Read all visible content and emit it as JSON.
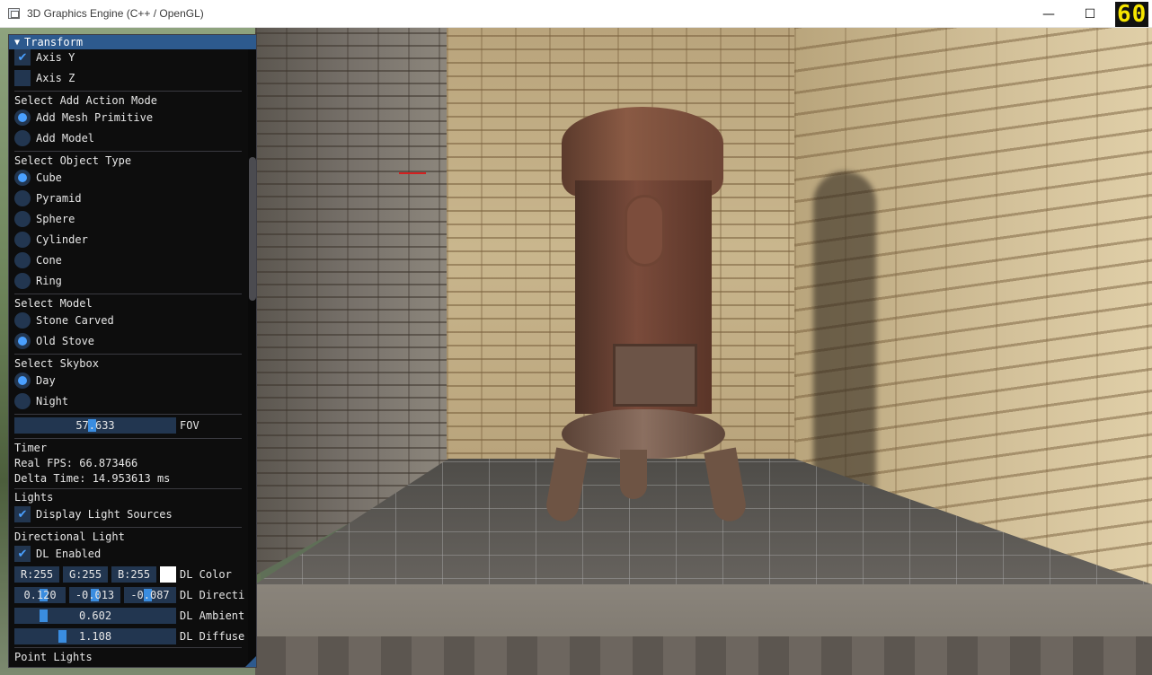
{
  "window": {
    "title": "3D Graphics Engine (C++ / OpenGL)",
    "minimize_glyph": "—",
    "maximize_glyph": "☐",
    "close_glyph": "✕"
  },
  "overlay": {
    "fps": "60"
  },
  "panel": {
    "header": "Transform",
    "axis": [
      {
        "label": "Axis Y",
        "checked": true
      },
      {
        "label": "Axis Z",
        "checked": false
      }
    ],
    "add_action": {
      "title": "Select Add Action Mode",
      "options": [
        {
          "label": "Add Mesh Primitive",
          "selected": true
        },
        {
          "label": "Add Model",
          "selected": false
        }
      ]
    },
    "object_type": {
      "title": "Select Object Type",
      "options": [
        {
          "label": "Cube",
          "selected": true
        },
        {
          "label": "Pyramid",
          "selected": false
        },
        {
          "label": "Sphere",
          "selected": false
        },
        {
          "label": "Cylinder",
          "selected": false
        },
        {
          "label": "Cone",
          "selected": false
        },
        {
          "label": "Ring",
          "selected": false
        }
      ]
    },
    "model": {
      "title": "Select Model",
      "options": [
        {
          "label": "Stone Carved",
          "selected": false
        },
        {
          "label": "Old Stove",
          "selected": true
        }
      ]
    },
    "skybox": {
      "title": "Select Skybox",
      "options": [
        {
          "label": "Day",
          "selected": true
        },
        {
          "label": "Night",
          "selected": false
        }
      ]
    },
    "fov": {
      "value": "57.633",
      "label": "FOV"
    },
    "timer": {
      "title": "Timer",
      "real_fps": "Real FPS: 66.873466",
      "delta_time": "Delta Time: 14.953613 ms"
    },
    "lights": {
      "title": "Lights",
      "display_sources": {
        "label": "Display Light Sources",
        "checked": true
      }
    },
    "directional": {
      "title": "Directional Light",
      "enabled": {
        "label": "DL Enabled",
        "checked": true
      },
      "color": {
        "r": "R:255",
        "g": "G:255",
        "b": "B:255",
        "label": "DL Color",
        "swatch": "#ffffff"
      },
      "direction": {
        "x": "0.120",
        "y": "-0.013",
        "z": "-0.087",
        "label": "DL Directi"
      },
      "ambient": {
        "value": "0.602",
        "label": "DL Ambient"
      },
      "diffuse": {
        "value": "1.108",
        "label": "DL Diffuse"
      }
    },
    "point_lights": {
      "title": "Point Lights"
    }
  },
  "colors": {
    "panel_bg": "#0d0d0d",
    "header_bg": "#2d5a8e",
    "frame_bg": "#223650",
    "accent": "#4aa0ff",
    "fps_text": "#f6e500"
  },
  "icons": {
    "checkmark": "check-icon",
    "collapse": "triangle-down-icon"
  }
}
